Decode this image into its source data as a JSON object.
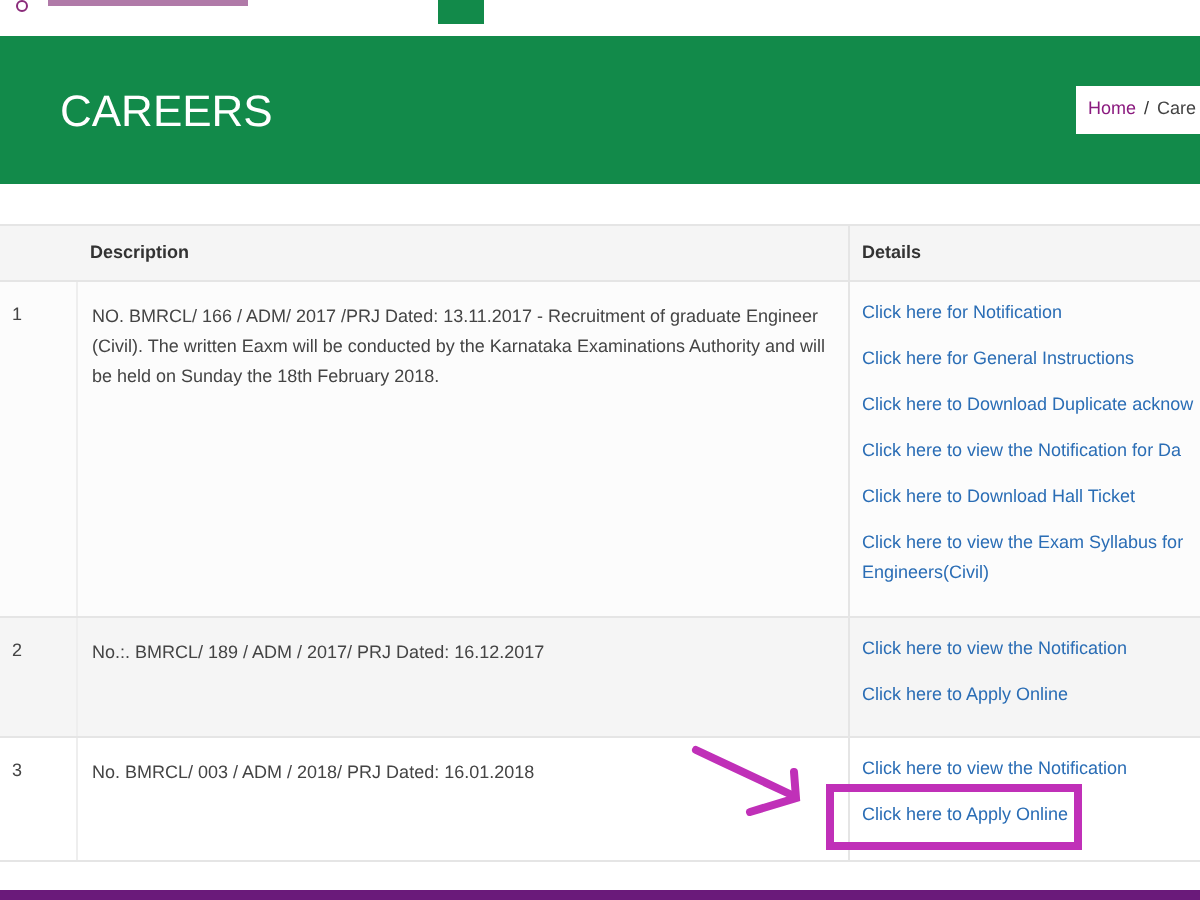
{
  "banner": {
    "title": "CAREERS",
    "breadcrumb_separator": "/",
    "breadcrumb": [
      {
        "label": "Home",
        "link": true
      },
      {
        "label": "Care",
        "link": false
      }
    ]
  },
  "table": {
    "columns": [
      "Description",
      "Details"
    ],
    "rows": [
      {
        "number": "1",
        "description": "NO. BMRCL/ 166 / ADM/ 2017 /PRJ Dated: 13.11.2017 - Recruitment of graduate Engineer (Civil). The written Eaxm will be conducted by the Karnataka Examinations Authority and will be held on Sunday the 18th February 2018.",
        "links": [
          {
            "label": "Click here for Notification",
            "highlighted": false
          },
          {
            "label": "Click here for General Instructions",
            "highlighted": false
          },
          {
            "label": "Click here to Download Duplicate acknow",
            "highlighted": false
          },
          {
            "label": "Click here to view the Notification for Da",
            "highlighted": false
          },
          {
            "label": "Click here to Download Hall Ticket",
            "highlighted": false
          },
          {
            "label": "Click here to view the Exam Syllabus for Engineers(Civil)",
            "highlighted": false
          }
        ]
      },
      {
        "number": "2",
        "description": "No.:. BMRCL/ 189 / ADM / 2017/ PRJ Dated: 16.12.2017",
        "links": [
          {
            "label": "Click here to view the Notification",
            "highlighted": false
          },
          {
            "label": "Click here to Apply Online",
            "highlighted": false
          }
        ]
      },
      {
        "number": "3",
        "description": "No. BMRCL/ 003 / ADM / 2018/ PRJ Dated: 16.01.2018",
        "links": [
          {
            "label": "Click here to view the Notification",
            "highlighted": false
          },
          {
            "label": "Click here to Apply Online",
            "highlighted": true
          }
        ]
      }
    ]
  }
}
